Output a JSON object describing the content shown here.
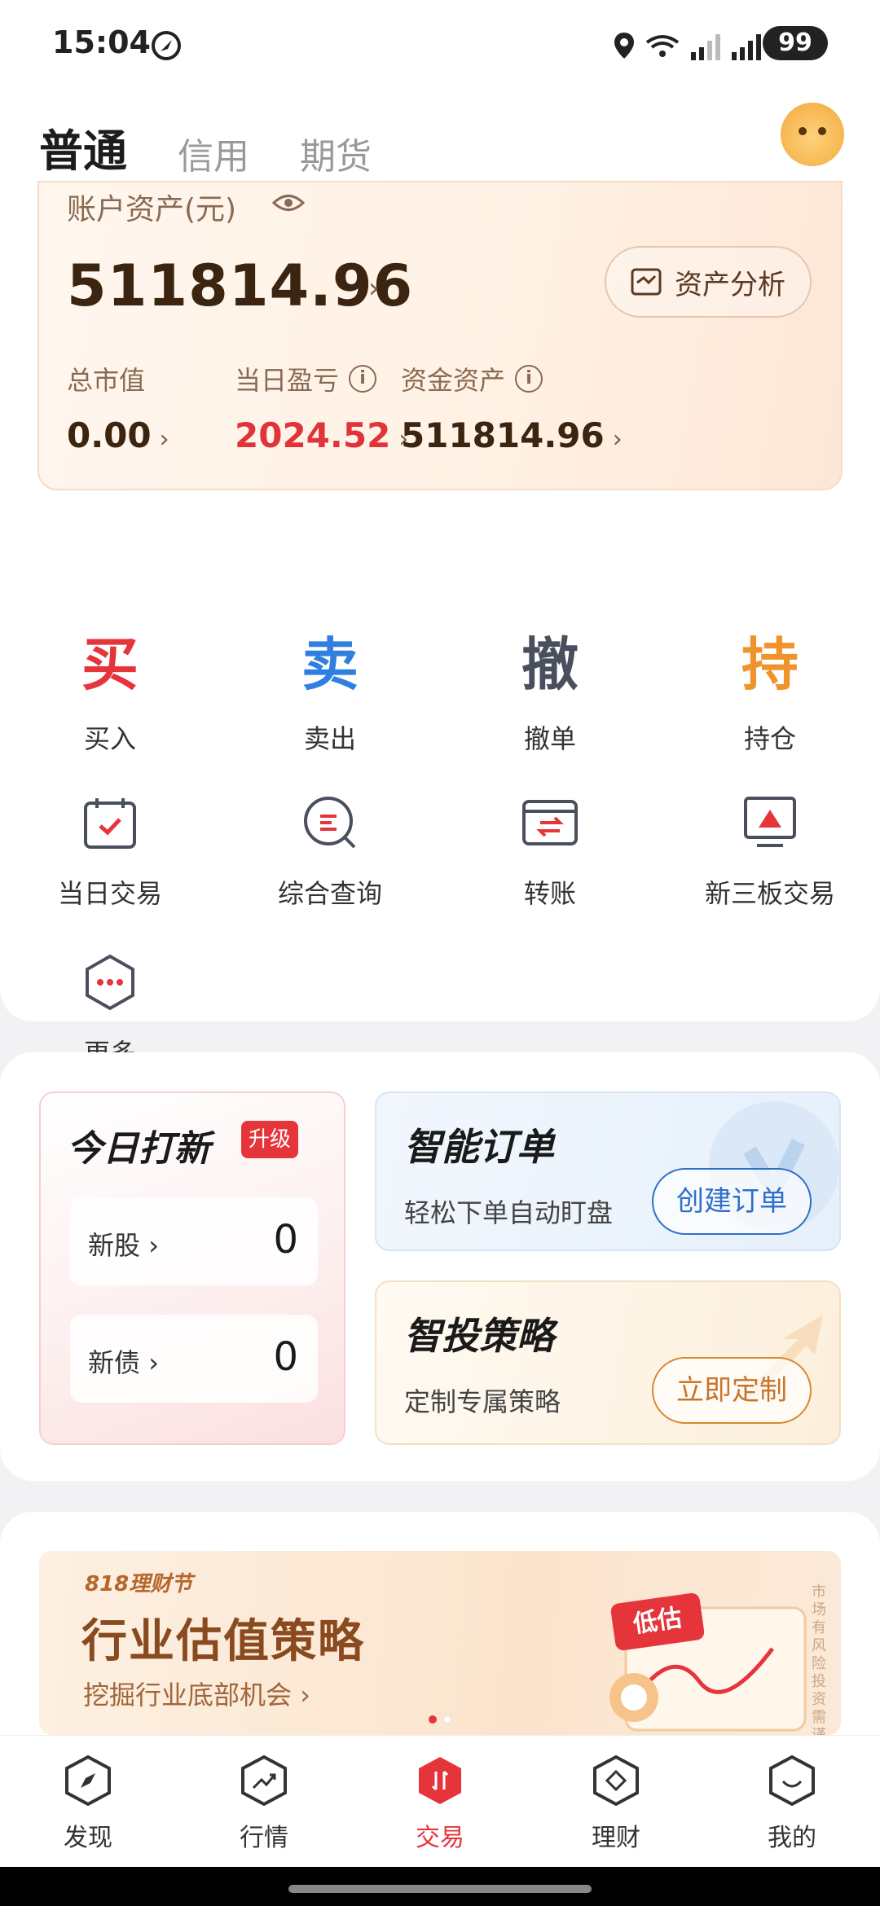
{
  "status_bar": {
    "time": "15:04",
    "battery": "99"
  },
  "account_tabs": [
    {
      "label": "普通",
      "active": true
    },
    {
      "label": "信用",
      "active": false
    },
    {
      "label": "期货",
      "active": false
    }
  ],
  "asset_card": {
    "label": "账户资产(元)",
    "total": "511814.96",
    "analysis_button": "资产分析",
    "metrics": [
      {
        "label": "总市值",
        "value": "0.00"
      },
      {
        "label": "当日盈亏",
        "value": "2024.52"
      },
      {
        "label": "资金资产",
        "value": "511814.96"
      }
    ]
  },
  "trade_actions": [
    {
      "glyph": "买",
      "label": "买入",
      "color": "#e5353b"
    },
    {
      "glyph": "卖",
      "label": "卖出",
      "color": "#2f7fe0"
    },
    {
      "glyph": "撤",
      "label": "撤单",
      "color": "#4a4f5e"
    },
    {
      "glyph": "持",
      "label": "持仓",
      "color": "#f0932b"
    }
  ],
  "functions": [
    {
      "label": "当日交易",
      "icon": "calendar-check-icon"
    },
    {
      "label": "综合查询",
      "icon": "search-query-icon"
    },
    {
      "label": "转账",
      "icon": "transfer-icon"
    },
    {
      "label": "新三板交易",
      "icon": "monitor-chart-icon"
    },
    {
      "label": "更多",
      "icon": "more-hexagon-icon"
    }
  ],
  "ipo_card": {
    "title": "今日打新",
    "badge": "升级",
    "rows": [
      {
        "label": "新股",
        "value": "0"
      },
      {
        "label": "新债",
        "value": "0"
      }
    ]
  },
  "smart_order": {
    "title": "智能订单",
    "subtitle": "轻松下单自动盯盘",
    "button": "创建订单"
  },
  "smart_strategy": {
    "title": "智投策略",
    "subtitle": "定制专属策略",
    "button": "立即定制"
  },
  "banner": {
    "tag": "818理财节",
    "title": "行业估值策略",
    "subtitle": "挖掘行业底部机会",
    "badge": "低估",
    "risk_note": "市场有风险 投资需谨慎"
  },
  "bottom_nav": [
    {
      "label": "发现",
      "icon": "compass-icon",
      "active": false
    },
    {
      "label": "行情",
      "icon": "trend-icon",
      "active": false
    },
    {
      "label": "交易",
      "icon": "trade-icon",
      "active": true
    },
    {
      "label": "理财",
      "icon": "wealth-icon",
      "active": false
    },
    {
      "label": "我的",
      "icon": "profile-icon",
      "active": false
    }
  ],
  "colors": {
    "accent_red": "#e5353b",
    "accent_blue": "#2f6fc7",
    "accent_orange": "#f0932b"
  }
}
